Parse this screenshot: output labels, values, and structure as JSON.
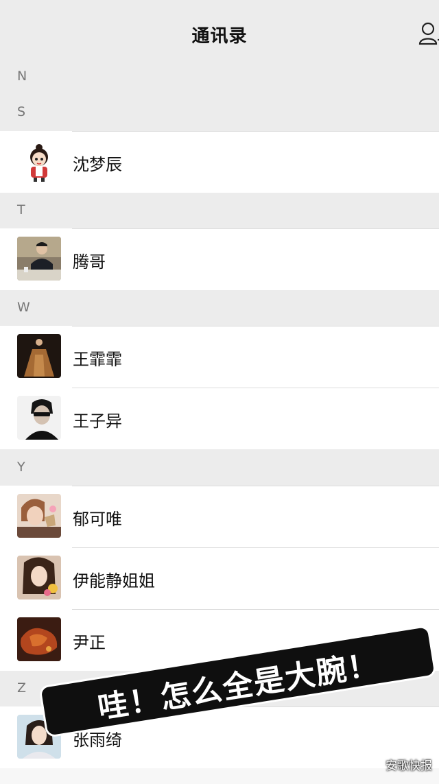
{
  "header": {
    "title": "通讯录",
    "add_icon": "add-contact-icon"
  },
  "sections": {
    "n": "N",
    "s": "S",
    "t": "T",
    "w": "W",
    "y": "Y",
    "z": "Z"
  },
  "contacts": {
    "shen": "沈梦辰",
    "teng": "腾哥",
    "wangfei": "王霏霏",
    "wangzi": "王子异",
    "yu": "郁可唯",
    "yi": "伊能静姐姐",
    "yin": "尹正",
    "zhang": "张雨绮"
  },
  "overlay": {
    "sticker_text": "哇！怎么全是大腕！"
  },
  "watermark": "安歌快报"
}
